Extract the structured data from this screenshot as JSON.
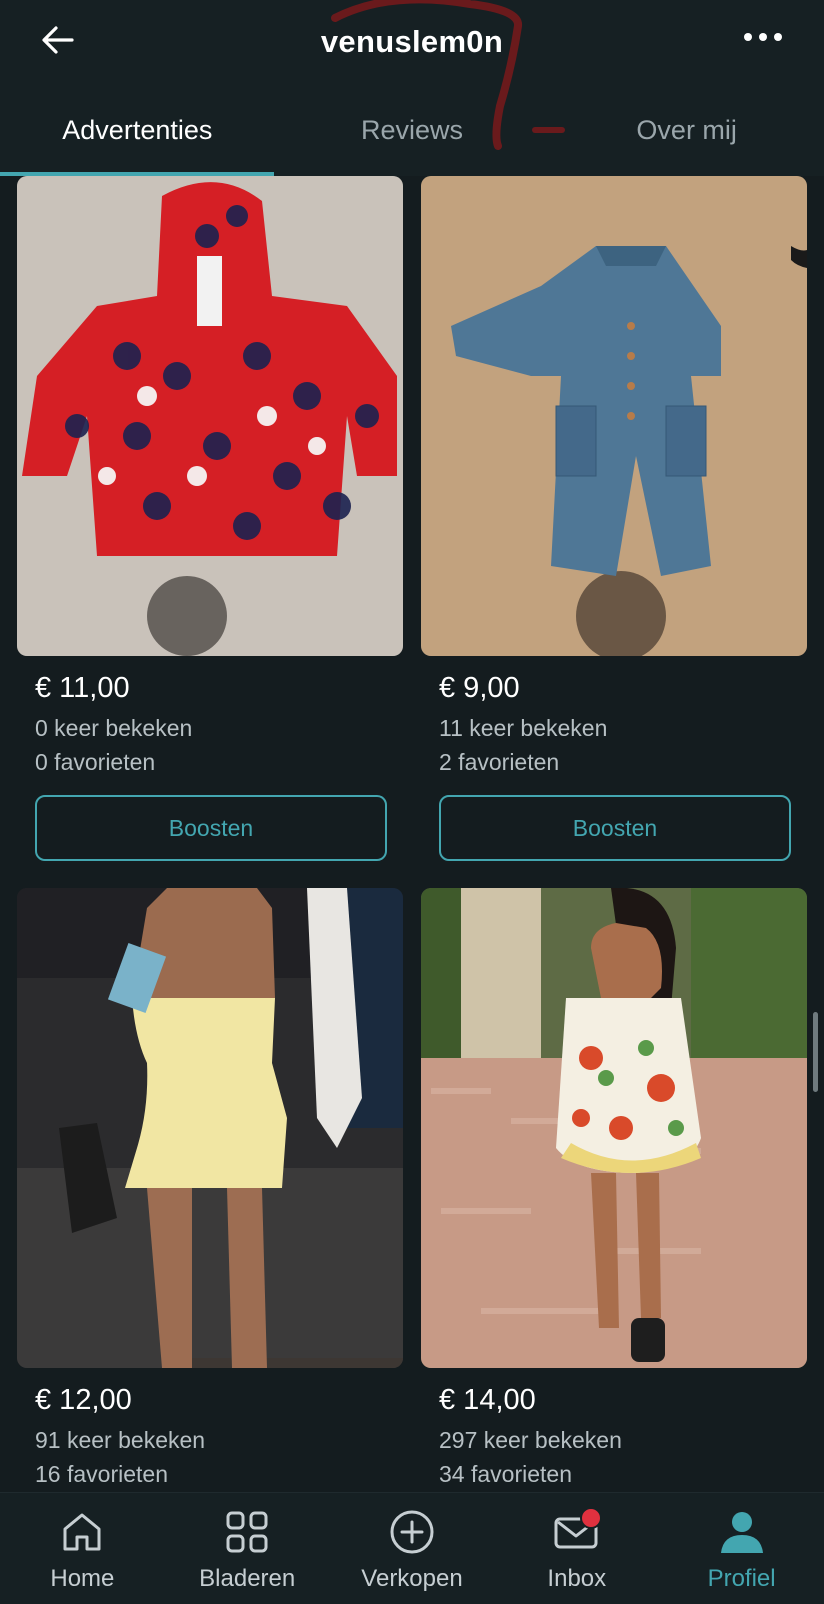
{
  "header": {
    "title": "venuslem0n",
    "back_icon": "arrow-left-icon",
    "more_icon": "more-dots-icon"
  },
  "tabs": [
    {
      "label": "Advertenties",
      "active": true
    },
    {
      "label": "Reviews",
      "active": false
    },
    {
      "label": "Over mij",
      "active": false
    }
  ],
  "listings": [
    {
      "price": "€ 11,00",
      "views": "0 keer bekeken",
      "favorites": "0 favorieten",
      "boost_label": "Boosten",
      "image": "red-panda-rain-jacket"
    },
    {
      "price": "€ 9,00",
      "views": "11 keer bekeken",
      "favorites": "2 favorieten",
      "boost_label": "Boosten",
      "image": "denim-baby-jumpsuit"
    },
    {
      "price": "€ 12,00",
      "views": "91 keer bekeken",
      "favorites": "16 favorieten",
      "image": "yellow-strapless-dress"
    },
    {
      "price": "€ 14,00",
      "views": "297 keer bekeken",
      "favorites": "34 favorieten",
      "image": "floral-halter-dress"
    }
  ],
  "bottom_nav": [
    {
      "label": "Home",
      "icon": "home-icon",
      "active": false
    },
    {
      "label": "Bladeren",
      "icon": "grid-icon",
      "active": false
    },
    {
      "label": "Verkopen",
      "icon": "plus-circle-icon",
      "active": false
    },
    {
      "label": "Inbox",
      "icon": "mail-icon",
      "active": false,
      "badge": true
    },
    {
      "label": "Profiel",
      "icon": "profile-icon",
      "active": true
    }
  ],
  "colors": {
    "background": "#141c1f",
    "accent": "#43a6b0",
    "badge": "#e0313f",
    "text_secondary": "#b7c0c4"
  }
}
